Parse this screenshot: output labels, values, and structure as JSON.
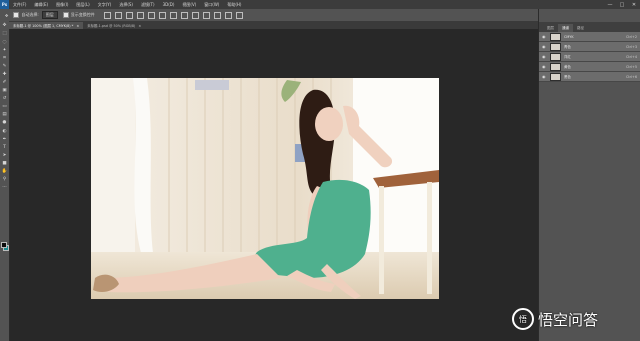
{
  "app": {
    "logo": "Ps",
    "menu": [
      "文件(F)",
      "编辑(E)",
      "图像(I)",
      "图层(L)",
      "文字(Y)",
      "选择(S)",
      "滤镜(T)",
      "3D(D)",
      "视图(V)",
      "窗口(W)",
      "帮助(H)"
    ],
    "window_controls": [
      "—",
      "□",
      "✕"
    ]
  },
  "options": {
    "auto_select_label": "自动选择:",
    "auto_select_value": "图层",
    "transform_label": "显示变换控件"
  },
  "tabs": [
    {
      "label": "未标题-1 @ 100% (图层 1, CMYK/8) *",
      "close": "×"
    },
    {
      "label": "未标题-1.psd @ 50% (RGB/8)",
      "close": "×"
    }
  ],
  "panel": {
    "tabs": [
      "图层",
      "通道",
      "路径"
    ],
    "channels": [
      {
        "name": "CMYK",
        "key": "Ctrl+2"
      },
      {
        "name": "青色",
        "key": "Ctrl+3"
      },
      {
        "name": "洋红",
        "key": "Ctrl+4"
      },
      {
        "name": "黄色",
        "key": "Ctrl+5"
      },
      {
        "name": "黑色",
        "key": "Ctrl+6"
      }
    ]
  },
  "tools": [
    "move-icon",
    "marquee-icon",
    "lasso-icon",
    "magic-wand-icon",
    "crop-icon",
    "eyedropper-icon",
    "healing-icon",
    "brush-icon",
    "stamp-icon",
    "history-brush-icon",
    "eraser-icon",
    "gradient-icon",
    "blur-icon",
    "dodge-icon",
    "pen-icon",
    "type-icon",
    "path-select-icon",
    "shape-icon",
    "hand-icon",
    "zoom-icon",
    "more-icon"
  ],
  "watermark": {
    "logo": "悟",
    "text": "悟空问答"
  },
  "colors": {
    "foreground": "#0c0c0c",
    "background": "#1b8a8f",
    "accent": "#1f5f9b"
  }
}
